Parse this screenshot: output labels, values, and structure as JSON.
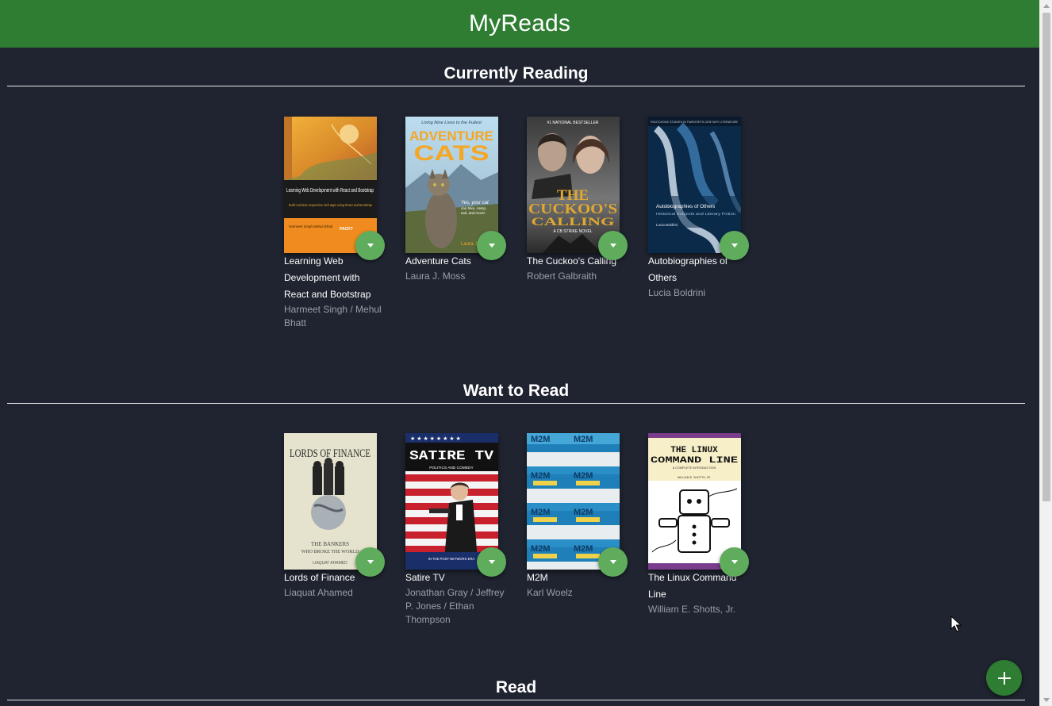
{
  "app": {
    "title": "MyReads"
  },
  "shelves": [
    {
      "title": "Currently Reading",
      "books": [
        {
          "title": "Learning Web Development with React and Bootstrap",
          "authors": "Harmeet Singh / Mehul Bhatt",
          "cover": {
            "text": "Learning Web Development with React and Bootstrap",
            "subtitle": "Build real-time responsive web apps using React and Bootstrap",
            "publisher": "PACKT",
            "author_text": "Harmeet Singh Mehul Bhatt"
          }
        },
        {
          "title": "Adventure Cats",
          "authors": "Laura J. Moss",
          "cover": {
            "tagline": "Living Nine Lives to the Fullest",
            "line1": "ADVENTURE",
            "line2": "CATS",
            "blurb1": "Yes, your cat",
            "blurb2": "can hike, camp,",
            "blurb3": "sail, and more!",
            "author_text": "Laura J."
          }
        },
        {
          "title": "The Cuckoo's Calling",
          "authors": "Robert Galbraith",
          "cover": {
            "top": "#1 NATIONAL BESTSELLER",
            "line1": "THE",
            "line2": "CUCKOO'S",
            "line3": "CALLING",
            "series": "A CB STRIKE NOVEL"
          }
        },
        {
          "title": "Autobiographies of Others",
          "authors": "Lucia Boldrini",
          "cover": {
            "series": "ROUTLEDGE STUDIES IN TWENTIETH-CENTURY LITERATURE",
            "line1": "Autobiographies of Others",
            "line2": "Historical Subjects and Literary Fiction",
            "author_text": "Lucia Boldrini"
          }
        }
      ]
    },
    {
      "title": "Want to Read",
      "books": [
        {
          "title": "Lords of Finance",
          "authors": "Liaquat Ahamed",
          "cover": {
            "line1": "LORDS OF FINANCE",
            "line2": "THE BANKERS",
            "line3": "WHO BROKE THE WORLD",
            "author_text": "LIAQUAT AHAMED"
          }
        },
        {
          "title": "Satire TV",
          "authors": "Jonathan Gray / Jeffrey P. Jones / Ethan Thompson",
          "cover": {
            "line1": "SATIRE TV",
            "line2": "POLITICS AND COMEDY",
            "line3": "IN THE POST-NETWORK ERA"
          }
        },
        {
          "title": "M2M",
          "authors": "Karl Woelz",
          "cover": {
            "tile": "M2M"
          }
        },
        {
          "title": "The Linux Command Line",
          "authors": "William E. Shotts, Jr.",
          "cover": {
            "line1": "THE LINUX",
            "line2": "COMMAND LINE",
            "line3": "A COMPLETE INTRODUCTION",
            "author_text": "WILLIAM E. SHOTTS, JR."
          }
        }
      ]
    },
    {
      "title": "Read",
      "books": []
    }
  ],
  "colors": {
    "header": "#2e7d32",
    "background": "#1f2430",
    "changer": "#60ac5d",
    "add_button": "#2e7d32"
  },
  "icons": {
    "shelf_changer": "arrow-drop-down-icon",
    "add": "plus-icon"
  }
}
